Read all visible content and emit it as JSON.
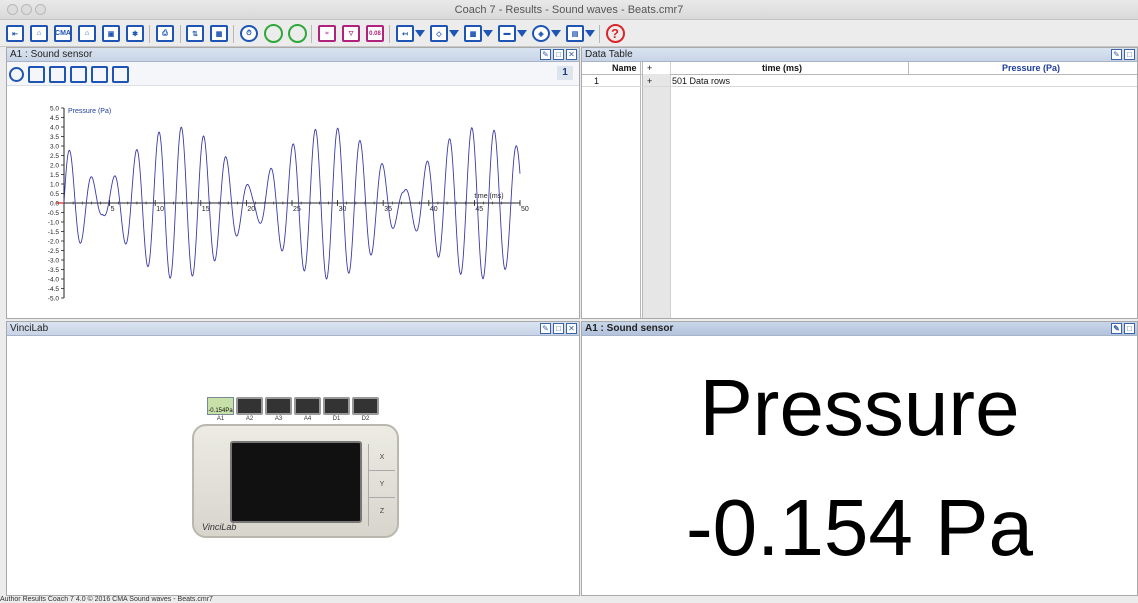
{
  "window": {
    "title": "Coach 7 - Results - Sound waves - Beats.cmr7"
  },
  "toolbar": {
    "cma_label": "CMA",
    "value_label": "0.08",
    "help_label": "?"
  },
  "graph_panel": {
    "title": "A1 : Sound sensor",
    "page_number": "1",
    "y_label": "Pressure (Pa)",
    "x_label": "time (ms)",
    "y_ticks": [
      "5.0",
      "4.5",
      "4.0",
      "3.5",
      "3.0",
      "2.5",
      "2.0",
      "1.5",
      "1.0",
      "0.5",
      "0.0",
      "-0.5",
      "-1.0",
      "-1.5",
      "-2.0",
      "-2.5",
      "-3.0",
      "-3.5",
      "-4.0",
      "-4.5",
      "-5.0"
    ],
    "x_ticks": [
      "5",
      "10",
      "15",
      "20",
      "25",
      "30",
      "35",
      "40",
      "45",
      "50"
    ]
  },
  "chart_data": {
    "type": "line",
    "x_range": [
      0,
      50
    ],
    "y_range": [
      -5,
      5
    ],
    "series": [
      {
        "name": "Pressure (Pa)",
        "color": "#3a3aa8"
      }
    ],
    "signal": {
      "amplitude": 4.0,
      "carrier_period_ms": 2.45,
      "beat_period_ms": 16.5,
      "phase_ms": 12.5
    }
  },
  "data_table": {
    "title": "Data Table",
    "col_name": "Name",
    "col_time": "time (ms)",
    "col_pressure": "Pressure (Pa)",
    "row_index": "1",
    "row_text": "501 Data rows",
    "plus": "+"
  },
  "vincilab": {
    "title": "VinciLab",
    "ports": [
      "A1",
      "A2",
      "A3",
      "A4",
      "D1",
      "D2"
    ],
    "sensor_reading": "-0.154Pa",
    "brand": "VinciLab",
    "buttons": [
      "X",
      "Y",
      "Z"
    ]
  },
  "meter_panel": {
    "title": "A1 : Sound sensor",
    "quantity": "Pressure",
    "value": "-0.154 Pa"
  },
  "status": {
    "text": "Author                    Results                    Coach 7 4.0 © 2016 CMA       Sound waves - Beats.cmr7"
  }
}
